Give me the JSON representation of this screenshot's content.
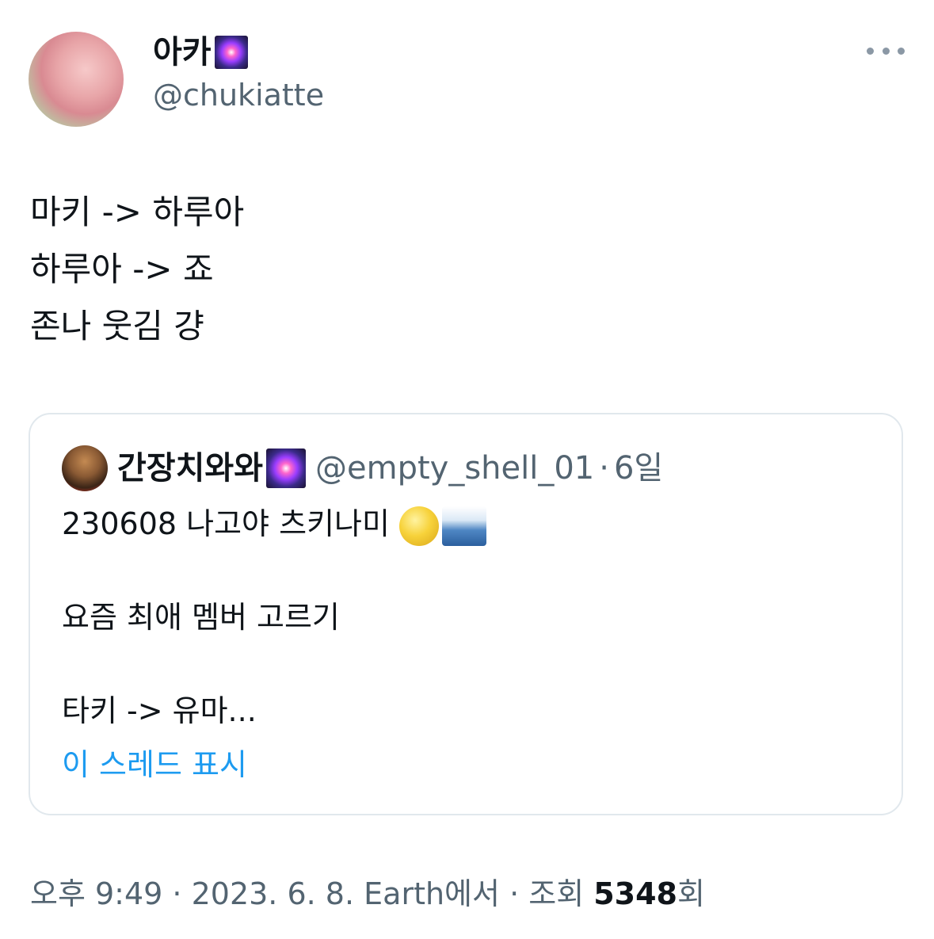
{
  "author": {
    "display_name": "아카",
    "name_emoji": "fireworks-emoji",
    "handle": "@chukiatte",
    "avatar": "avatar-image"
  },
  "more_icon": "more-horizontal-icon",
  "tweet": {
    "lines": [
      "마키 -> 하루아",
      "하루아 -> 죠",
      "존나 웃김 걍"
    ]
  },
  "quote": {
    "display_name": "간장치와와",
    "name_emoji": "fireworks-emoji",
    "handle": "@empty_shell_01",
    "separator": "·",
    "time": "6일",
    "line1": "230608 나고야 츠키나미",
    "line1_emojis": [
      "full-moon-emoji",
      "water-wave-emoji"
    ],
    "line2": "요즘 최애 멤버 고르기",
    "line3": "타키 -> 유마...",
    "show_thread": "이 스레드 표시"
  },
  "meta": {
    "time": "오후 9:49",
    "sep1": " · ",
    "date": "2023. 6. 8.",
    "source": "Earth에서",
    "sep2": " · ",
    "views_prefix": "조회 ",
    "views": "5348",
    "views_suffix": "회"
  }
}
